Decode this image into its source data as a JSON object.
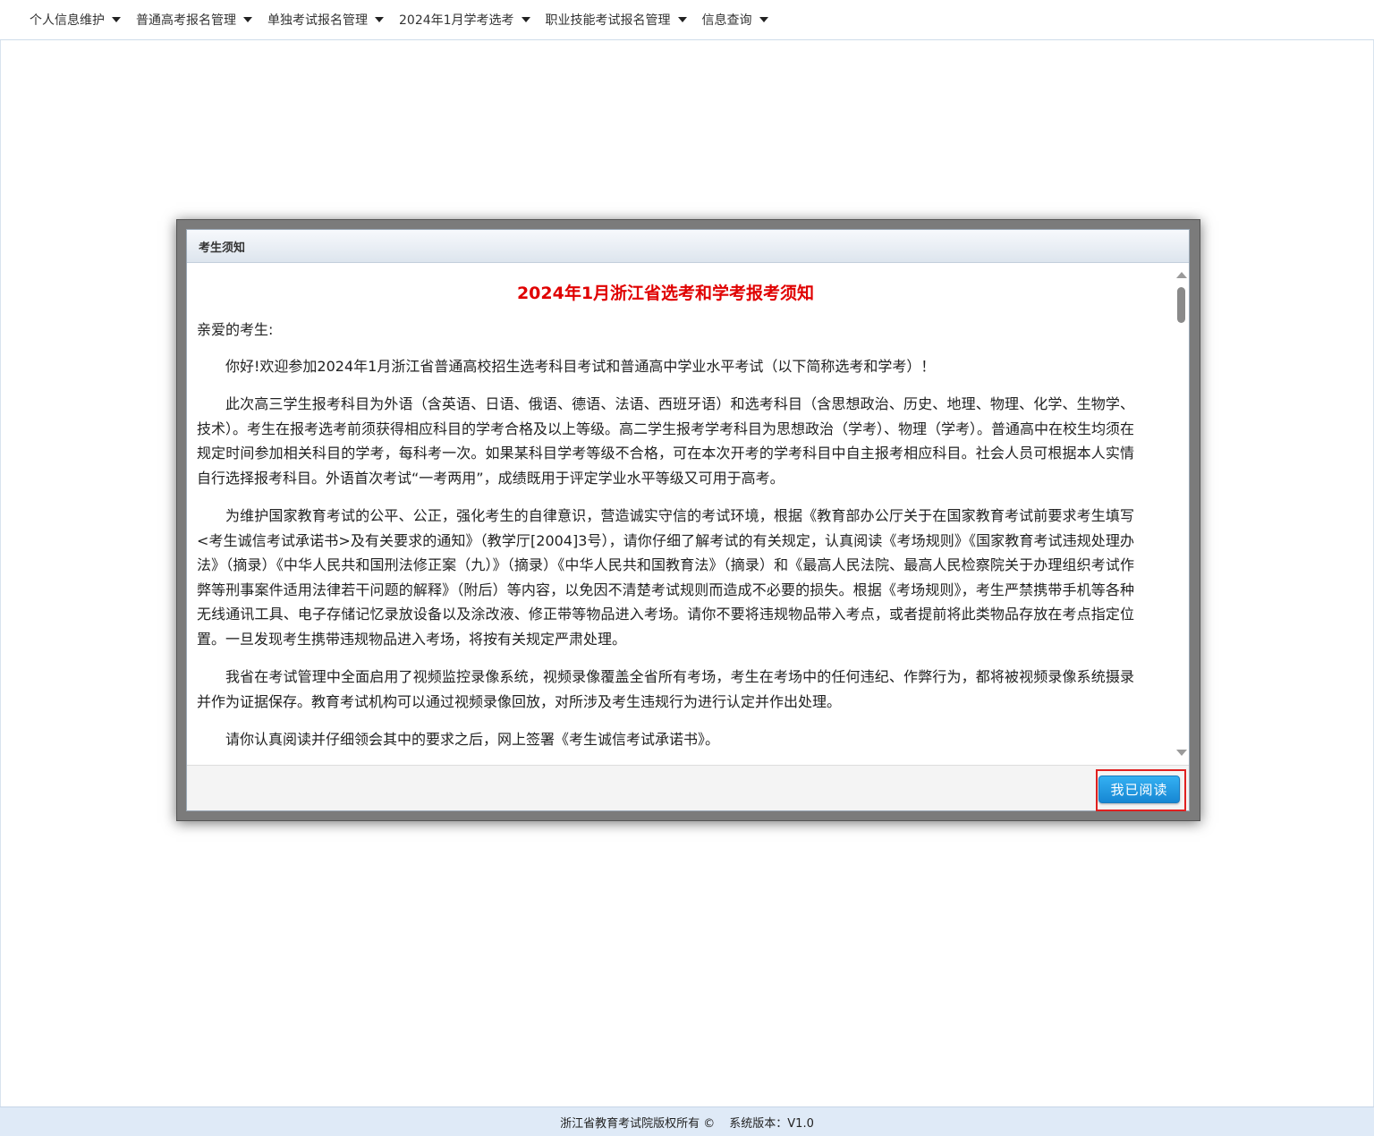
{
  "nav": {
    "items": [
      {
        "label": "个人信息维护"
      },
      {
        "label": "普通高考报名管理"
      },
      {
        "label": "单独考试报名管理"
      },
      {
        "label": "2024年1月学考选考"
      },
      {
        "label": "职业技能考试报名管理"
      },
      {
        "label": "信息查询"
      }
    ]
  },
  "dialog": {
    "header": "考生须知",
    "title": "2024年1月浙江省选考和学考报考须知",
    "greeting": "亲爱的考生:",
    "paragraphs": [
      "你好!欢迎参加2024年1月浙江省普通高校招生选考科目考试和普通高中学业水平考试（以下简称选考和学考）！",
      "此次高三学生报考科目为外语（含英语、日语、俄语、德语、法语、西班牙语）和选考科目（含思想政治、历史、地理、物理、化学、生物学、技术）。考生在报考选考前须获得相应科目的学考合格及以上等级。高二学生报考学考科目为思想政治（学考）、物理（学考）。普通高中在校生均须在规定时间参加相关科目的学考，每科考一次。如果某科目学考等级不合格，可在本次开考的学考科目中自主报考相应科目。社会人员可根据本人实情自行选择报考科目。外语首次考试“一考两用”，成绩既用于评定学业水平等级又可用于高考。",
      "为维护国家教育考试的公平、公正，强化考生的自律意识，营造诚实守信的考试环境，根据《教育部办公厅关于在国家教育考试前要求考生填写<考生诚信考试承诺书>及有关要求的通知》（教学厅[2004]3号），请你仔细了解考试的有关规定，认真阅读《考场规则》《国家教育考试违规处理办法》（摘录）《中华人民共和国刑法修正案（九）》（摘录）《中华人民共和国教育法》（摘录）和《最高人民法院、最高人民检察院关于办理组织考试作弊等刑事案件适用法律若干问题的解释》（附后）等内容，以免因不清楚考试规则而造成不必要的损失。根据《考场规则》，考生严禁携带手机等各种无线通讯工具、电子存储记忆录放设备以及涂改液、修正带等物品进入考场。请你不要将违规物品带入考点，或者提前将此类物品存放在考点指定位置。一旦发现考生携带违规物品进入考场，将按有关规定严肃处理。",
      "我省在考试管理中全面启用了视频监控录像系统，视频录像覆盖全省所有考场，考生在考场中的任何违纪、作弊行为，都将被视频录像系统摄录并作为证据保存。教育考试机构可以通过视频录像回放，对所涉及考生违规行为进行认定并作出处理。",
      "请你认真阅读并仔细领会其中的要求之后，网上签署《考生诚信考试承诺书》。"
    ],
    "button_label": "我已阅读"
  },
  "footer": {
    "copyright": "浙江省教育考试院版权所有 ©",
    "version": "系统版本：V1.0"
  },
  "colors": {
    "title_red": "#e00000",
    "button_blue": "#1787d3",
    "highlight_red": "#e02020",
    "footer_bg": "#dfeaf7"
  }
}
